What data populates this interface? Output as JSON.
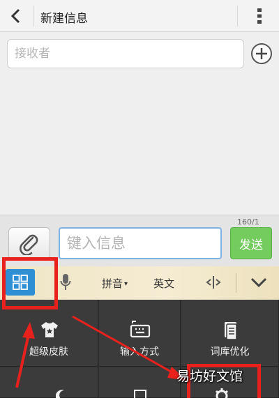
{
  "header": {
    "title": "新建信息"
  },
  "recipient": {
    "placeholder": "接收者"
  },
  "compose": {
    "counter": "160/1",
    "message_placeholder": "键入信息",
    "send_label": "发送"
  },
  "ime": {
    "pinyin_label": "拼音",
    "english_label": "英文"
  },
  "panel": {
    "items": [
      {
        "label": "超级皮肤",
        "icon": "tshirt-icon"
      },
      {
        "label": "输入方式",
        "icon": "keyboard-icon"
      },
      {
        "label": "词库优化",
        "icon": "book-icon"
      }
    ]
  },
  "watermark": {
    "text": "易坊好文馆"
  },
  "colors": {
    "send": "#74cc5e",
    "ime_active": "#2f8fd4",
    "annotation": "#e8211c",
    "panel": "#2f2f2f"
  }
}
